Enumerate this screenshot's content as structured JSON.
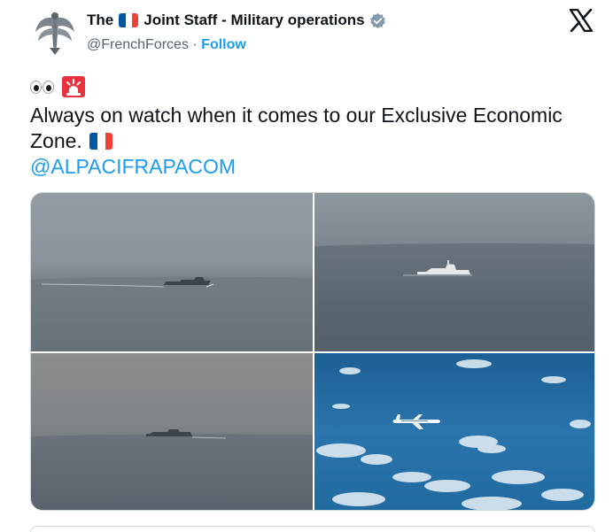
{
  "author": {
    "name_prefix": "The",
    "name_suffix": "Joint Staff - Military operations",
    "handle": "@FrenchForces",
    "separator": "·",
    "follow_label": "Follow",
    "verified_color": "#829aab"
  },
  "tweet": {
    "text": "Always on watch when it comes to our Exclusive Economic Zone.",
    "mention": "@ALPACIFRAPACOM",
    "emojis": [
      "eyes",
      "rotating-light"
    ]
  },
  "media": {
    "photos": [
      {
        "subject": "grey warship on calm sea"
      },
      {
        "subject": "white frigate on open sea"
      },
      {
        "subject": "distant ship in haze"
      },
      {
        "subject": "surveillance aircraft over blue ocean"
      }
    ]
  },
  "colors": {
    "accent": "#1d9bf0",
    "text": "#0f1419",
    "secondary": "#536471",
    "flag_blue": "#0055a4",
    "flag_red": "#ef4135"
  }
}
